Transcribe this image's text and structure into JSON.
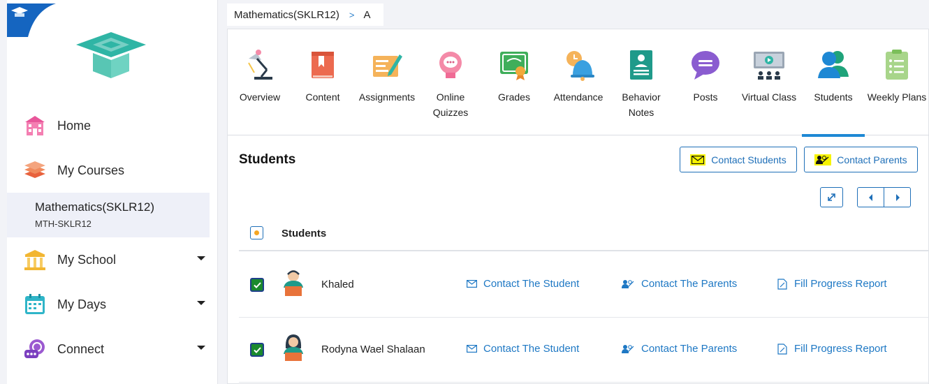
{
  "sidebar": {
    "items": [
      {
        "label": "Home",
        "icon": "school-building-icon"
      },
      {
        "label": "My Courses",
        "icon": "book-stack-icon"
      },
      {
        "label": "My School",
        "icon": "columns-building-icon"
      },
      {
        "label": "My Days",
        "icon": "calendar-icon"
      },
      {
        "label": "Connect",
        "icon": "chat-bubble-icon"
      }
    ],
    "active_course": {
      "title": "Mathematics(SKLR12)",
      "code": "MTH-SKLR12"
    }
  },
  "breadcrumb": {
    "course": "Mathematics(SKLR12)",
    "separator": ">",
    "section": "A"
  },
  "tabs": [
    {
      "label": "Overview",
      "icon": "desk-lamp-icon"
    },
    {
      "label": "Content",
      "icon": "book-icon"
    },
    {
      "label": "Assignments",
      "icon": "pen-paper-icon"
    },
    {
      "label": "Online Quizzes",
      "icon": "chat-head-icon"
    },
    {
      "label": "Grades",
      "icon": "certificate-icon"
    },
    {
      "label": "Attendance",
      "icon": "bell-clock-icon"
    },
    {
      "label": "Behavior Notes",
      "icon": "notes-board-icon"
    },
    {
      "label": "Posts",
      "icon": "speech-bubble-icon"
    },
    {
      "label": "Virtual Class",
      "icon": "virtual-class-icon"
    },
    {
      "label": "Students",
      "icon": "students-icon"
    },
    {
      "label": "Weekly Plans",
      "icon": "clipboard-icon"
    }
  ],
  "students_section": {
    "title": "Students",
    "contact_students": "Contact Students",
    "contact_parents": "Contact Parents",
    "column_header": "Students"
  },
  "students": [
    {
      "name": "Khaled",
      "contact_student": "Contact The Student",
      "contact_parents": "Contact The Parents",
      "progress_report": "Fill Progress Report",
      "checked": true
    },
    {
      "name": "Rodyna Wael Shalaan",
      "contact_student": "Contact The Student",
      "contact_parents": "Contact The Parents",
      "progress_report": "Fill Progress Report",
      "checked": true
    }
  ],
  "colors": {
    "accent": "#1e78c4",
    "active_tab_underline": "#1e88d4",
    "highlight": "#f6f300"
  }
}
